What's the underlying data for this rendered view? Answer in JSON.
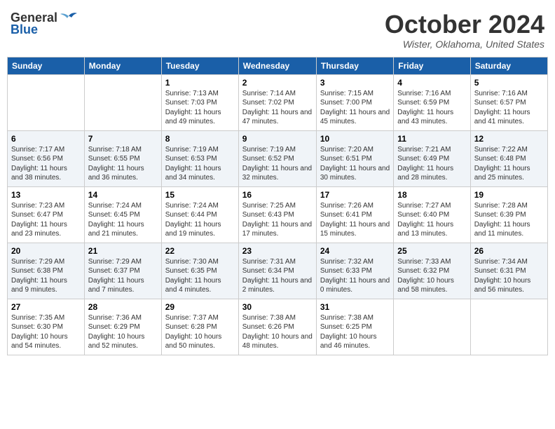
{
  "header": {
    "logo_line1": "General",
    "logo_line2": "Blue",
    "month_title": "October 2024",
    "location": "Wister, Oklahoma, United States"
  },
  "weekdays": [
    "Sunday",
    "Monday",
    "Tuesday",
    "Wednesday",
    "Thursday",
    "Friday",
    "Saturday"
  ],
  "weeks": [
    [
      {
        "day": "",
        "sunrise": "",
        "sunset": "",
        "daylight": ""
      },
      {
        "day": "",
        "sunrise": "",
        "sunset": "",
        "daylight": ""
      },
      {
        "day": "1",
        "sunrise": "Sunrise: 7:13 AM",
        "sunset": "Sunset: 7:03 PM",
        "daylight": "Daylight: 11 hours and 49 minutes."
      },
      {
        "day": "2",
        "sunrise": "Sunrise: 7:14 AM",
        "sunset": "Sunset: 7:02 PM",
        "daylight": "Daylight: 11 hours and 47 minutes."
      },
      {
        "day": "3",
        "sunrise": "Sunrise: 7:15 AM",
        "sunset": "Sunset: 7:00 PM",
        "daylight": "Daylight: 11 hours and 45 minutes."
      },
      {
        "day": "4",
        "sunrise": "Sunrise: 7:16 AM",
        "sunset": "Sunset: 6:59 PM",
        "daylight": "Daylight: 11 hours and 43 minutes."
      },
      {
        "day": "5",
        "sunrise": "Sunrise: 7:16 AM",
        "sunset": "Sunset: 6:57 PM",
        "daylight": "Daylight: 11 hours and 41 minutes."
      }
    ],
    [
      {
        "day": "6",
        "sunrise": "Sunrise: 7:17 AM",
        "sunset": "Sunset: 6:56 PM",
        "daylight": "Daylight: 11 hours and 38 minutes."
      },
      {
        "day": "7",
        "sunrise": "Sunrise: 7:18 AM",
        "sunset": "Sunset: 6:55 PM",
        "daylight": "Daylight: 11 hours and 36 minutes."
      },
      {
        "day": "8",
        "sunrise": "Sunrise: 7:19 AM",
        "sunset": "Sunset: 6:53 PM",
        "daylight": "Daylight: 11 hours and 34 minutes."
      },
      {
        "day": "9",
        "sunrise": "Sunrise: 7:19 AM",
        "sunset": "Sunset: 6:52 PM",
        "daylight": "Daylight: 11 hours and 32 minutes."
      },
      {
        "day": "10",
        "sunrise": "Sunrise: 7:20 AM",
        "sunset": "Sunset: 6:51 PM",
        "daylight": "Daylight: 11 hours and 30 minutes."
      },
      {
        "day": "11",
        "sunrise": "Sunrise: 7:21 AM",
        "sunset": "Sunset: 6:49 PM",
        "daylight": "Daylight: 11 hours and 28 minutes."
      },
      {
        "day": "12",
        "sunrise": "Sunrise: 7:22 AM",
        "sunset": "Sunset: 6:48 PM",
        "daylight": "Daylight: 11 hours and 25 minutes."
      }
    ],
    [
      {
        "day": "13",
        "sunrise": "Sunrise: 7:23 AM",
        "sunset": "Sunset: 6:47 PM",
        "daylight": "Daylight: 11 hours and 23 minutes."
      },
      {
        "day": "14",
        "sunrise": "Sunrise: 7:24 AM",
        "sunset": "Sunset: 6:45 PM",
        "daylight": "Daylight: 11 hours and 21 minutes."
      },
      {
        "day": "15",
        "sunrise": "Sunrise: 7:24 AM",
        "sunset": "Sunset: 6:44 PM",
        "daylight": "Daylight: 11 hours and 19 minutes."
      },
      {
        "day": "16",
        "sunrise": "Sunrise: 7:25 AM",
        "sunset": "Sunset: 6:43 PM",
        "daylight": "Daylight: 11 hours and 17 minutes."
      },
      {
        "day": "17",
        "sunrise": "Sunrise: 7:26 AM",
        "sunset": "Sunset: 6:41 PM",
        "daylight": "Daylight: 11 hours and 15 minutes."
      },
      {
        "day": "18",
        "sunrise": "Sunrise: 7:27 AM",
        "sunset": "Sunset: 6:40 PM",
        "daylight": "Daylight: 11 hours and 13 minutes."
      },
      {
        "day": "19",
        "sunrise": "Sunrise: 7:28 AM",
        "sunset": "Sunset: 6:39 PM",
        "daylight": "Daylight: 11 hours and 11 minutes."
      }
    ],
    [
      {
        "day": "20",
        "sunrise": "Sunrise: 7:29 AM",
        "sunset": "Sunset: 6:38 PM",
        "daylight": "Daylight: 11 hours and 9 minutes."
      },
      {
        "day": "21",
        "sunrise": "Sunrise: 7:29 AM",
        "sunset": "Sunset: 6:37 PM",
        "daylight": "Daylight: 11 hours and 7 minutes."
      },
      {
        "day": "22",
        "sunrise": "Sunrise: 7:30 AM",
        "sunset": "Sunset: 6:35 PM",
        "daylight": "Daylight: 11 hours and 4 minutes."
      },
      {
        "day": "23",
        "sunrise": "Sunrise: 7:31 AM",
        "sunset": "Sunset: 6:34 PM",
        "daylight": "Daylight: 11 hours and 2 minutes."
      },
      {
        "day": "24",
        "sunrise": "Sunrise: 7:32 AM",
        "sunset": "Sunset: 6:33 PM",
        "daylight": "Daylight: 11 hours and 0 minutes."
      },
      {
        "day": "25",
        "sunrise": "Sunrise: 7:33 AM",
        "sunset": "Sunset: 6:32 PM",
        "daylight": "Daylight: 10 hours and 58 minutes."
      },
      {
        "day": "26",
        "sunrise": "Sunrise: 7:34 AM",
        "sunset": "Sunset: 6:31 PM",
        "daylight": "Daylight: 10 hours and 56 minutes."
      }
    ],
    [
      {
        "day": "27",
        "sunrise": "Sunrise: 7:35 AM",
        "sunset": "Sunset: 6:30 PM",
        "daylight": "Daylight: 10 hours and 54 minutes."
      },
      {
        "day": "28",
        "sunrise": "Sunrise: 7:36 AM",
        "sunset": "Sunset: 6:29 PM",
        "daylight": "Daylight: 10 hours and 52 minutes."
      },
      {
        "day": "29",
        "sunrise": "Sunrise: 7:37 AM",
        "sunset": "Sunset: 6:28 PM",
        "daylight": "Daylight: 10 hours and 50 minutes."
      },
      {
        "day": "30",
        "sunrise": "Sunrise: 7:38 AM",
        "sunset": "Sunset: 6:26 PM",
        "daylight": "Daylight: 10 hours and 48 minutes."
      },
      {
        "day": "31",
        "sunrise": "Sunrise: 7:38 AM",
        "sunset": "Sunset: 6:25 PM",
        "daylight": "Daylight: 10 hours and 46 minutes."
      },
      {
        "day": "",
        "sunrise": "",
        "sunset": "",
        "daylight": ""
      },
      {
        "day": "",
        "sunrise": "",
        "sunset": "",
        "daylight": ""
      }
    ]
  ]
}
